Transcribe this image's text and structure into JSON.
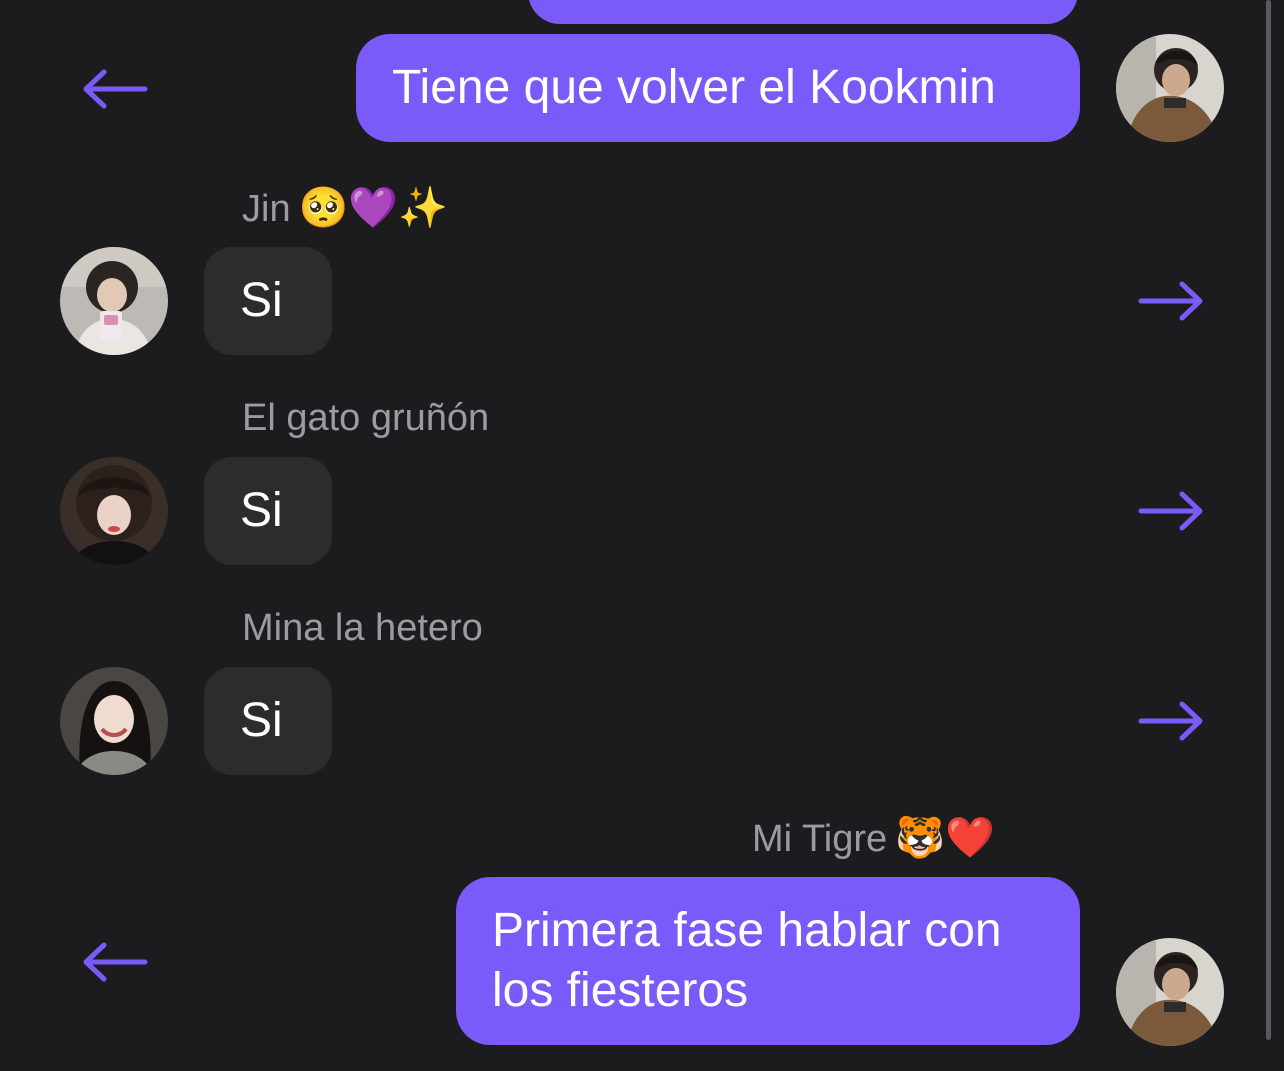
{
  "colors": {
    "background": "#1c1c1e",
    "outgoing_bubble": "#7a5af8",
    "incoming_bubble": "#2c2c2e",
    "sender_name": "#9b9ba1",
    "accent_arrow": "#7a5af8"
  },
  "messages": [
    {
      "direction": "outgoing",
      "text": "Tiene que volver el Kookmin",
      "avatar": "avatar-self-photo",
      "action_icon": "arrow-left-icon"
    },
    {
      "direction": "incoming",
      "sender": "Jin",
      "sender_emoji": "🥺💜✨",
      "text": "Si",
      "avatar": "avatar-jin-photo",
      "action_icon": "arrow-right-icon"
    },
    {
      "direction": "incoming",
      "sender": "El gato gruñón",
      "text": "Si",
      "avatar": "avatar-gato-photo",
      "action_icon": "arrow-right-icon"
    },
    {
      "direction": "incoming",
      "sender": "Mina la hetero",
      "text": "Si",
      "avatar": "avatar-mina-photo",
      "action_icon": "arrow-right-icon"
    },
    {
      "direction": "outgoing",
      "sender": "Mi Tigre",
      "sender_emoji": "🐯❤️",
      "text": "Primera fase hablar con los fiesteros",
      "avatar": "avatar-self-photo",
      "action_icon": "arrow-left-icon"
    }
  ]
}
